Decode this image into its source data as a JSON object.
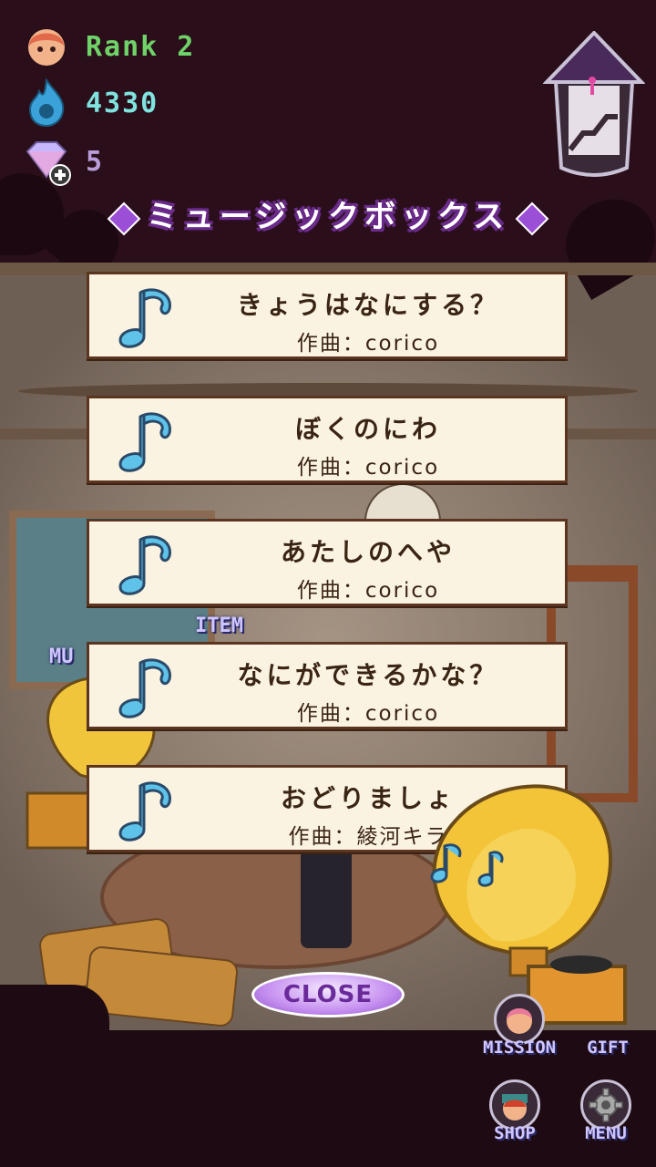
{
  "status": {
    "rank_label": "Rank 2",
    "points": "4330",
    "gems": "5"
  },
  "title": "ミュージックボックス",
  "songs": [
    {
      "title": "きょうはなにする？",
      "composer": "作曲：corico"
    },
    {
      "title": "ぼくのにわ",
      "composer": "作曲：corico"
    },
    {
      "title": "あたしのへや",
      "composer": "作曲：corico"
    },
    {
      "title": "なにができるかな？",
      "composer": "作曲：corico"
    },
    {
      "title": "おどりましょ",
      "composer": "作曲：綾河キラ"
    }
  ],
  "background_labels": {
    "item": "ITEM",
    "music_partial": "MU"
  },
  "close_label": "CLOSE",
  "menu": {
    "mission": "MISSION",
    "gift": "GIFT",
    "shop": "SHOP",
    "menu": "MENU"
  },
  "colors": {
    "rank_text": "#6fd36a",
    "points_text": "#7fe3e0",
    "gems_text": "#b79cd9",
    "title_outline": "#6a2a8a",
    "card_bg": "#fbf3e1",
    "note_blue": "#5fc2e8"
  },
  "icons": [
    "player-avatar-icon",
    "blue-flame-icon",
    "gem-plus-icon",
    "tower-house-icon",
    "music-note-icon",
    "gear-icon"
  ]
}
